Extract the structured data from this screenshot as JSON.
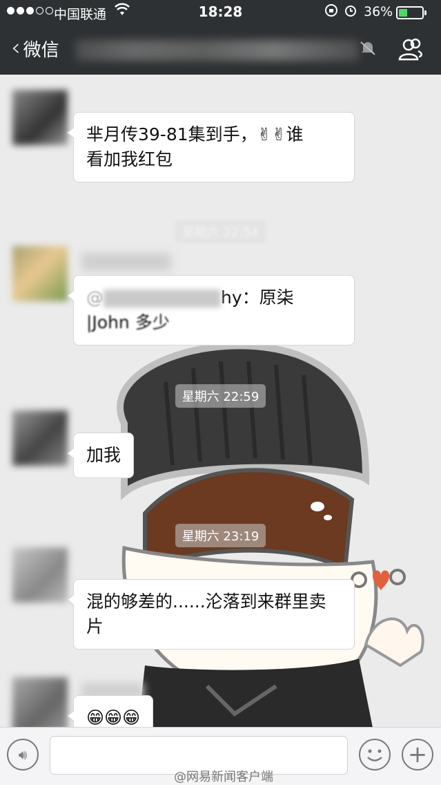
{
  "status_bar": {
    "carrier": "中国联通",
    "time": "18:28",
    "battery_percent": "36%",
    "battery_level": 0.36
  },
  "nav": {
    "back_label": "微信"
  },
  "messages": [
    {
      "text_line1": "芈月传39-81集到手，✌✌谁",
      "text_line2": "看加我红包"
    },
    {
      "time": "星期六 22:54"
    },
    {
      "text_prefix": "@",
      "text_mid": "hy：原柒",
      "text_line2": "|John 多少"
    },
    {
      "time": "星期六 22:59"
    },
    {
      "text": "加我"
    },
    {
      "time": "星期六 23:19"
    },
    {
      "text_line1": "混的够差的......沦落到来群里卖",
      "text_line2": "片"
    },
    {
      "text": "😁😁😁"
    }
  ],
  "watermark": "@网易新闻客户端",
  "colors": {
    "nav_bg": "#2e3133",
    "chat_bg": "#ebebeb",
    "battery": "#4cd964"
  }
}
